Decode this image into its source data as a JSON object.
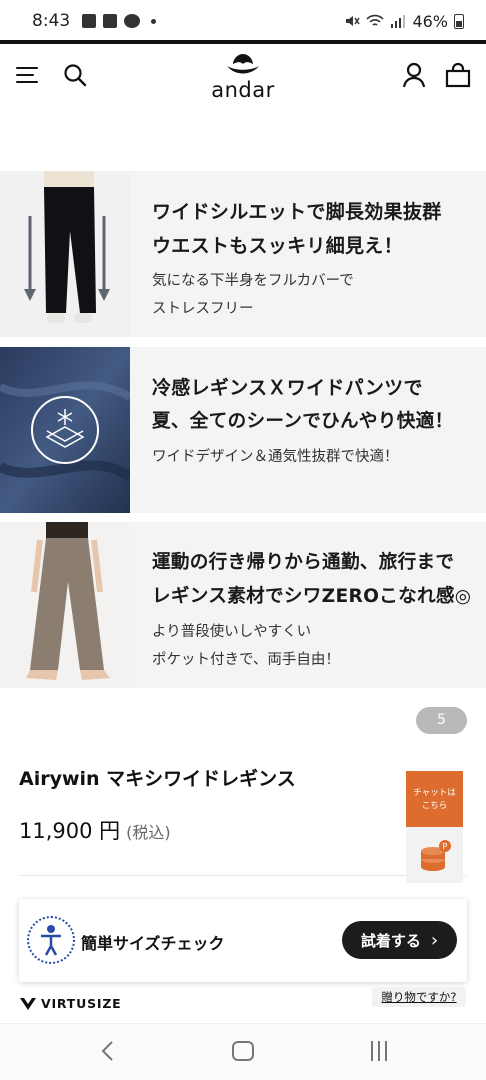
{
  "status_bar": {
    "time": "8:43",
    "battery": "46%"
  },
  "header": {
    "logo_text": "andar"
  },
  "features": [
    {
      "headline_1": "ワイドシルエットで脚長効果抜群",
      "headline_2": "ウエストもスッキリ細見え！",
      "sub_1": "気になる下半身をフルカバーで",
      "sub_2": "ストレスフリー"
    },
    {
      "headline_1": "冷感レギンスＸワイドパンツで",
      "headline_2": "夏、全てのシーンでひんやり快適！",
      "sub_1": "ワイドデザイン＆通気性抜群で快適！",
      "sub_2": ""
    },
    {
      "headline_1": "運動の行き帰りから通勤、旅行まで",
      "headline_2": "レギンス素材でシワZEROこなれ感◎",
      "sub_1": "より普段使いしやすくい",
      "sub_2": "ポケット付きで、両手自由！"
    }
  ],
  "pager": {
    "label": "5"
  },
  "product": {
    "title": "Airywin マキシワイドレギンス",
    "price": "11,900 円",
    "tax_note": "(税込)"
  },
  "chat": {
    "line_1": "チャットは",
    "line_2": "こちら"
  },
  "size_check": {
    "label": "簡単サイズチェック",
    "button": "試着する"
  },
  "virtusize": {
    "brand": "VIRTUSIZE"
  },
  "gift": {
    "link": "贈り物ですか?"
  },
  "colors": {
    "chat_orange": "#dd6d2f",
    "button_dark": "#1c1c1c",
    "panel_gray": "#f4f4f4",
    "virtusize_blue": "#2a4aa8"
  }
}
